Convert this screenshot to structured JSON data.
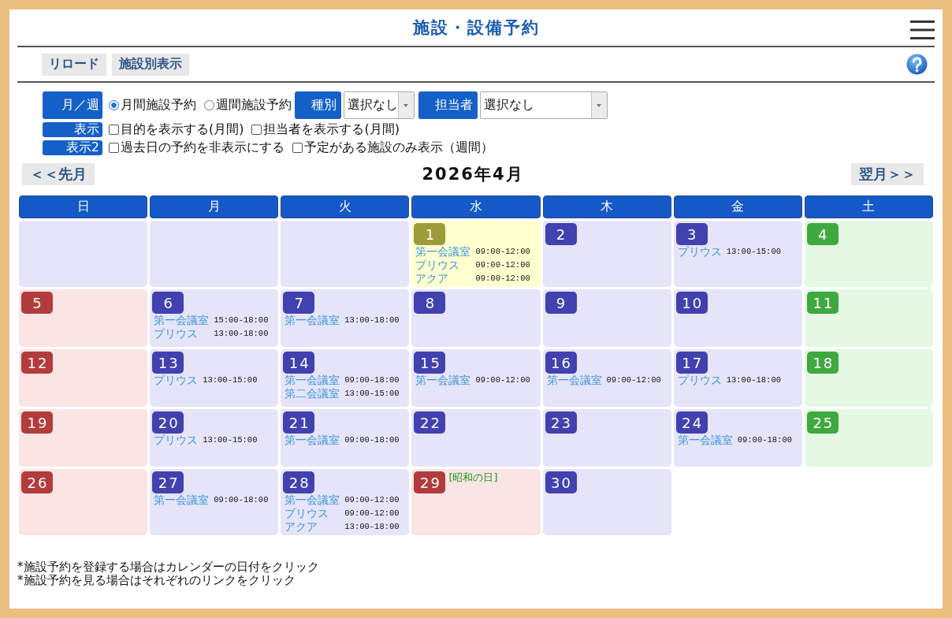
{
  "header": {
    "title": "施設・設備予約"
  },
  "toolbar": {
    "buttons": [
      "リロード",
      "施設別表示"
    ]
  },
  "filters": {
    "rows": [
      {
        "label": "月／週",
        "items": [
          {
            "kind": "radio",
            "label": "月間施設予約",
            "selected": true
          },
          {
            "kind": "radio",
            "label": "週間施設予約",
            "selected": false
          },
          {
            "kind": "select",
            "label": "種別",
            "value": "選択なし"
          },
          {
            "kind": "select",
            "label": "担当者",
            "value": "選択なし"
          }
        ]
      },
      {
        "label": "表示",
        "items": [
          {
            "kind": "checkbox",
            "label": "目的を表示する(月間)",
            "checked": false
          },
          {
            "kind": "checkbox",
            "label": "担当者を表示する(月間)",
            "checked": false
          }
        ]
      },
      {
        "label": "表示2",
        "items": [
          {
            "kind": "checkbox",
            "label": "過去日の予約を非表示にする",
            "checked": false
          },
          {
            "kind": "checkbox",
            "label": "予定がある施設のみ表示（週間）",
            "checked": false
          }
        ]
      }
    ]
  },
  "month_nav": {
    "previous": "＜＜先月",
    "title": "2026年4月",
    "next": "翌月＞＞"
  },
  "calendar": {
    "weekdays": [
      "日",
      "月",
      "火",
      "水",
      "木",
      "金",
      "土"
    ],
    "weeks": [
      [
        {
          "kind": "empty"
        },
        {
          "kind": "empty"
        },
        {
          "kind": "empty"
        },
        {
          "kind": "today",
          "day": "1",
          "events": [
            {
              "facility": "第一会議室",
              "time": "09:00-12:00"
            },
            {
              "facility": "プリウス",
              "time": "09:00-12:00"
            },
            {
              "facility": "アクア",
              "time": "09:00-12:00"
            }
          ]
        },
        {
          "kind": "weekday",
          "day": "2"
        },
        {
          "kind": "weekday",
          "day": "3",
          "events": [
            {
              "facility": "プリウス",
              "time": "13:00-15:00"
            }
          ]
        },
        {
          "kind": "saturday",
          "day": "4"
        }
      ],
      [
        {
          "kind": "sunday",
          "day": "5"
        },
        {
          "kind": "weekday",
          "day": "6",
          "events": [
            {
              "facility": "第一会議室",
              "time": "15:00-18:00"
            },
            {
              "facility": "プリウス",
              "time": "13:00-18:00"
            }
          ]
        },
        {
          "kind": "weekday",
          "day": "7",
          "events": [
            {
              "facility": "第一会議室",
              "time": "13:00-18:00"
            }
          ]
        },
        {
          "kind": "weekday",
          "day": "8"
        },
        {
          "kind": "weekday",
          "day": "9"
        },
        {
          "kind": "weekday",
          "day": "10"
        },
        {
          "kind": "saturday",
          "day": "11"
        }
      ],
      [
        {
          "kind": "sunday",
          "day": "12"
        },
        {
          "kind": "weekday",
          "day": "13",
          "events": [
            {
              "facility": "プリウス",
              "time": "13:00-15:00"
            }
          ]
        },
        {
          "kind": "weekday",
          "day": "14",
          "events": [
            {
              "facility": "第一会議室",
              "time": "09:00-18:00"
            },
            {
              "facility": "第二会議室",
              "time": "13:00-15:00"
            }
          ]
        },
        {
          "kind": "weekday",
          "day": "15",
          "events": [
            {
              "facility": "第一会議室",
              "time": "09:00-12:00"
            }
          ]
        },
        {
          "kind": "weekday",
          "day": "16",
          "events": [
            {
              "facility": "第一会議室",
              "time": "09:00-12:00"
            }
          ]
        },
        {
          "kind": "weekday",
          "day": "17",
          "events": [
            {
              "facility": "プリウス",
              "time": "13:00-18:00"
            }
          ]
        },
        {
          "kind": "saturday",
          "day": "18"
        }
      ],
      [
        {
          "kind": "sunday",
          "day": "19"
        },
        {
          "kind": "weekday",
          "day": "20",
          "events": [
            {
              "facility": "プリウス",
              "time": "13:00-15:00"
            }
          ]
        },
        {
          "kind": "weekday",
          "day": "21",
          "events": [
            {
              "facility": "第一会議室",
              "time": "09:00-18:00"
            }
          ]
        },
        {
          "kind": "weekday",
          "day": "22"
        },
        {
          "kind": "weekday",
          "day": "23"
        },
        {
          "kind": "weekday",
          "day": "24",
          "events": [
            {
              "facility": "第一会議室",
              "time": "09:00-18:00"
            }
          ]
        },
        {
          "kind": "saturday",
          "day": "25"
        }
      ],
      [
        {
          "kind": "sunday",
          "day": "26"
        },
        {
          "kind": "weekday",
          "day": "27",
          "events": [
            {
              "facility": "第一会議室",
              "time": "09:00-18:00"
            }
          ]
        },
        {
          "kind": "weekday",
          "day": "28",
          "events": [
            {
              "facility": "第一会議室",
              "time": "09:00-12:00"
            },
            {
              "facility": "プリウス",
              "time": "09:00-12:00"
            },
            {
              "facility": "アクア",
              "time": "13:00-18:00"
            }
          ]
        },
        {
          "kind": "holiday",
          "day": "29",
          "note": "[昭和の日]"
        },
        {
          "kind": "weekday",
          "day": "30"
        }
      ]
    ]
  },
  "notes": [
    "*施設予約を登録する場合はカレンダーの日付をクリック",
    "*施設予約を見る場合はそれぞれのリンクをクリック"
  ]
}
